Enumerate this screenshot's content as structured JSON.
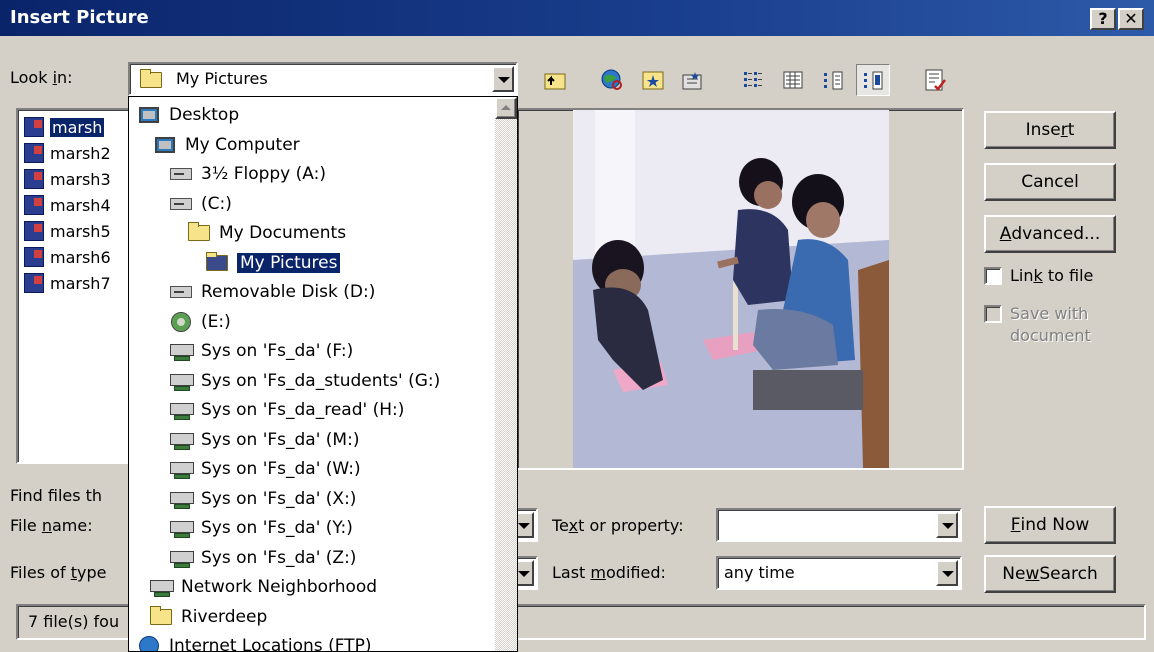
{
  "window": {
    "title": "Insert Picture",
    "help_btn": "?",
    "close_btn": "✕"
  },
  "look_in": {
    "label_pre": "Look ",
    "label_ul": "i",
    "label_post": "n:",
    "value": "My Pictures"
  },
  "files": [
    "marsh",
    "marsh2",
    "marsh3",
    "marsh4",
    "marsh5",
    "marsh6",
    "marsh7"
  ],
  "dropdown": [
    {
      "label": "Desktop",
      "icon": "desktop-icon"
    },
    {
      "label": "My Computer",
      "icon": "computer-icon"
    },
    {
      "label": "3½ Floppy (A:)",
      "icon": "floppy-drive-icon"
    },
    {
      "label": "(C:)",
      "icon": "hard-drive-icon"
    },
    {
      "label": "My Documents",
      "icon": "folder-icon"
    },
    {
      "label": "My Pictures",
      "icon": "folder-open-icon"
    },
    {
      "label": "Removable Disk (D:)",
      "icon": "removable-drive-icon"
    },
    {
      "label": "(E:)",
      "icon": "cd-drive-icon"
    },
    {
      "label": "Sys on 'Fs_da' (F:)",
      "icon": "network-drive-icon"
    },
    {
      "label": "Sys on 'Fs_da_students' (G:)",
      "icon": "network-drive-icon"
    },
    {
      "label": "Sys on 'Fs_da_read' (H:)",
      "icon": "network-drive-icon"
    },
    {
      "label": "Sys on 'Fs_da' (M:)",
      "icon": "network-drive-icon"
    },
    {
      "label": "Sys on 'Fs_da' (W:)",
      "icon": "network-drive-icon"
    },
    {
      "label": "Sys on 'Fs_da' (X:)",
      "icon": "network-drive-icon"
    },
    {
      "label": "Sys on 'Fs_da' (Y:)",
      "icon": "network-drive-icon"
    },
    {
      "label": "Sys on 'Fs_da' (Z:)",
      "icon": "network-drive-icon"
    },
    {
      "label": "Network Neighborhood",
      "icon": "network-neighborhood-icon"
    },
    {
      "label": "Riverdeep",
      "icon": "folder-icon"
    },
    {
      "label": "Internet Locations (FTP)",
      "icon": "globe-icon"
    }
  ],
  "buttons": {
    "insert_pre": "Inse",
    "insert_ul": "r",
    "insert_post": "t",
    "cancel": "Cancel",
    "advanced_ul": "A",
    "advanced_post": "dvanced...",
    "find_now_ul": "F",
    "find_now_post": "ind Now",
    "new_search_pre": "Ne",
    "new_search_ul": "w",
    "new_search_post": " Search"
  },
  "options": {
    "link_pre": "Lin",
    "link_ul": "k",
    "link_post": " to file",
    "save_with_document": "Save with document"
  },
  "search": {
    "find_files_label": "Find files th",
    "file_name_pre": "File ",
    "file_name_ul": "n",
    "file_name_post": "ame:",
    "files_of_type_pre": "Files of ",
    "files_of_type_ul": "t",
    "files_of_type_post": "ype",
    "text_prop_pre": "Te",
    "text_prop_ul": "x",
    "text_prop_post": "t or property:",
    "text_prop_value": "",
    "last_mod_pre": "Last ",
    "last_mod_ul": "m",
    "last_mod_post": "odified:",
    "last_mod_value": "any time"
  },
  "status": {
    "text": "7 file(s) fou"
  }
}
